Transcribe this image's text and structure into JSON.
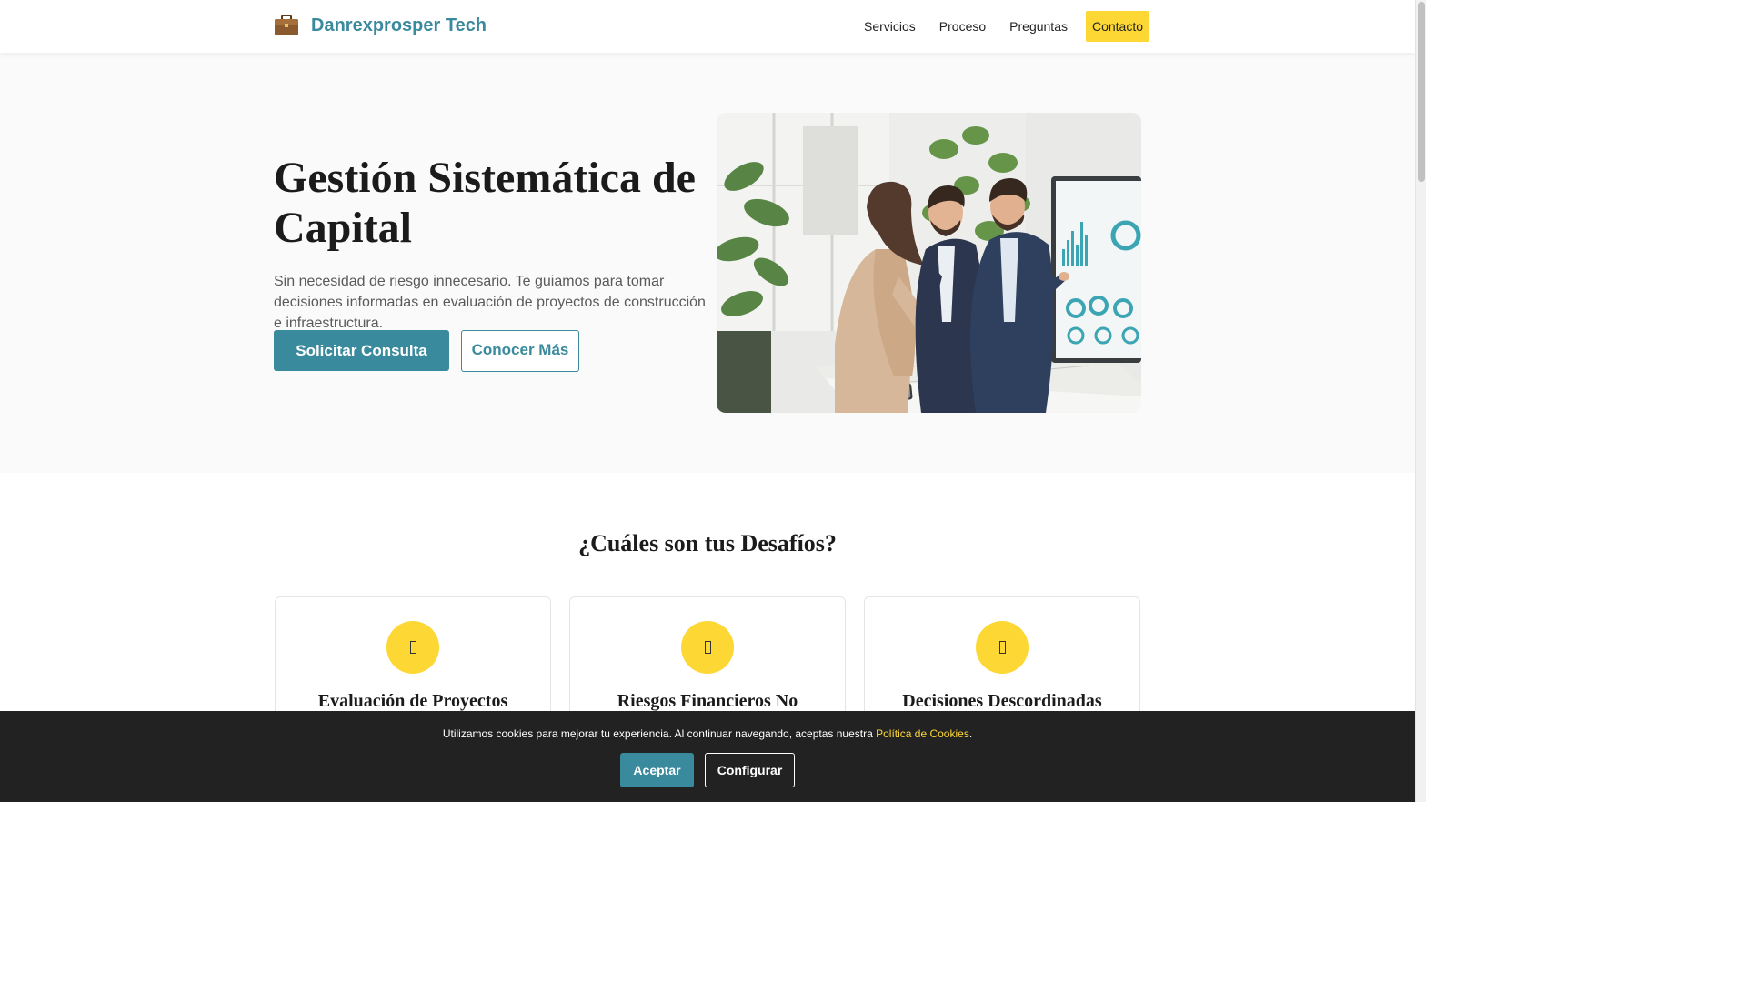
{
  "header": {
    "brand_name": "Danrexprosper Tech",
    "brand_icon": "briefcase-icon",
    "nav": [
      "Servicios",
      "Proceso",
      "Preguntas"
    ],
    "cta": "Contacto"
  },
  "hero": {
    "title": "Gestión Sistemática de Capital",
    "description": "Sin necesidad de riesgo innecesario. Te guiamos para tomar decisiones informadas en evaluación de proyectos de construcción e infraestructura.",
    "primary_button": "Solicitar Consulta",
    "secondary_button": "Conocer Más"
  },
  "challenges": {
    "title": "¿Cuáles son tus Desafíos?",
    "cards": [
      {
        "title": "Evaluación de Proyectos",
        "icon": "missing-glyph-icon"
      },
      {
        "title": "Riesgos Financieros No",
        "icon": "missing-glyph-icon"
      },
      {
        "title": "Decisiones Descordinadas",
        "icon": "missing-glyph-icon"
      }
    ]
  },
  "cookie_banner": {
    "text": "Utilizamos cookies para mejorar tu experiencia. Al continuar navegando, aceptas nuestra ",
    "link": "Política de Cookies",
    "suffix": ".",
    "accept": "Aceptar",
    "configure": "Configurar"
  },
  "colors": {
    "accent": "#3a8a9e",
    "highlight": "#fdd835",
    "banner": "#222222"
  }
}
